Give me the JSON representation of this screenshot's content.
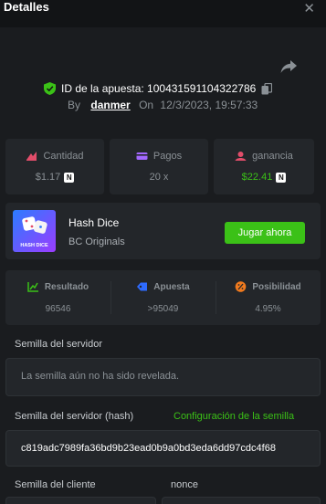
{
  "header": {
    "title": "Detalles",
    "close_icon": "close-icon"
  },
  "bet": {
    "id_label": "ID de la apuesta: 100431591104322786",
    "by_label": "By",
    "user": "danmer",
    "on_label": "On",
    "datetime": "12/3/2023, 19:57:33"
  },
  "stats": [
    {
      "label": "Cantidad",
      "value": "$1.17",
      "icon": "amount-icon",
      "color": "#e24d6a"
    },
    {
      "label": "Pagos",
      "value": "20 x",
      "icon": "payout-icon",
      "color": "#a368ff"
    },
    {
      "label": "ganancia",
      "value": "$22.41",
      "icon": "profit-icon",
      "color": "#e24d6a",
      "value_color": "#3bc117"
    }
  ],
  "currency_badge": "N",
  "game": {
    "name": "Hash Dice",
    "provider": "BC Originals",
    "thumb_caption": "HASH DICE",
    "play_label": "Jugar ahora"
  },
  "results": [
    {
      "label": "Resultado",
      "value": "96546",
      "icon": "result-chart-icon",
      "color": "#3bc117"
    },
    {
      "label": "Apuesta",
      "value": ">95049",
      "icon": "bet-tag-icon",
      "color": "#2e6bff"
    },
    {
      "label": "Posibilidad",
      "value": "4.95%",
      "icon": "percent-icon",
      "color": "#f07a1e"
    }
  ],
  "seeds": {
    "server_label": "Semilla del servidor",
    "server_value": "La semilla aún no ha sido revelada.",
    "hash_label": "Semilla del servidor (hash)",
    "config_link": "Configuración de la semilla",
    "hash_value": "c819adc7989fa36bd9b23ead0b9a0bd3eda6dd97cdc4f68",
    "client_label": "Semilla del cliente",
    "nonce_label": "nonce"
  },
  "colors": {
    "accent": "#3bc117",
    "background": "#1a1c1f",
    "panel": "#23262a"
  }
}
